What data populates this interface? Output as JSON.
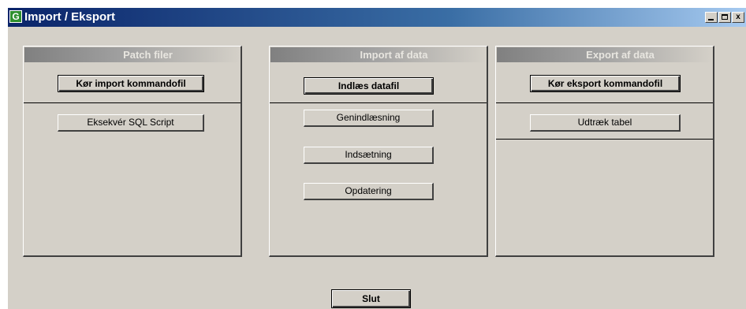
{
  "window": {
    "title": "Import / Eksport",
    "icon_glyph": "G",
    "controls": {
      "minimize_icon": "minimize-icon",
      "maximize_icon": "maximize-icon",
      "close_icon": "close-icon",
      "close_glyph": "x"
    }
  },
  "panels": [
    {
      "title": "Patch filer",
      "primary_button": "Kør import kommandofil",
      "buttons": [
        "Eksekvér SQL Script"
      ]
    },
    {
      "title": "Import af data",
      "primary_button": "Indlæs datafil",
      "buttons": [
        "Genindlæsning",
        "Indsætning",
        "Opdatering"
      ]
    },
    {
      "title": "Export af data",
      "primary_button": "Kør eksport kommandofil",
      "buttons": [
        "Udtræk tabel"
      ]
    }
  ],
  "footer": {
    "exit_label": "Slut"
  },
  "colors": {
    "window_bg": "#d4d0c8",
    "titlebar_start": "#0a246a",
    "titlebar_end": "#a6caf0",
    "panel_header_start": "#808080"
  }
}
